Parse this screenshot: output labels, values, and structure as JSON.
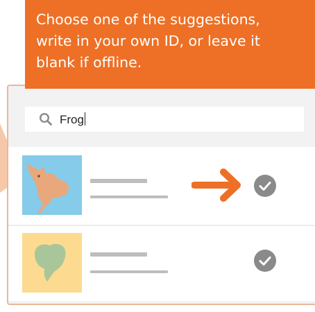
{
  "instructions": {
    "lines": [
      "Choose one of the suggestions,",
      "write in your own ID, or leave it",
      "blank if offline."
    ]
  },
  "search": {
    "value": "Frog",
    "icon": "search-icon"
  },
  "suggestions": [
    {
      "thumbnail": "bird-silhouette",
      "thumbnail_color": "#86cbe9",
      "highlighted": true,
      "action_icon": "check-circle-icon"
    },
    {
      "thumbnail": "leaf-silhouette",
      "thumbnail_color": "#fcdb90",
      "highlighted": false,
      "action_icon": "check-circle-icon"
    }
  ],
  "colors": {
    "accent": "#ed7026",
    "placeholder_line": "#bdbdbd",
    "check": "#8a8a8a"
  }
}
